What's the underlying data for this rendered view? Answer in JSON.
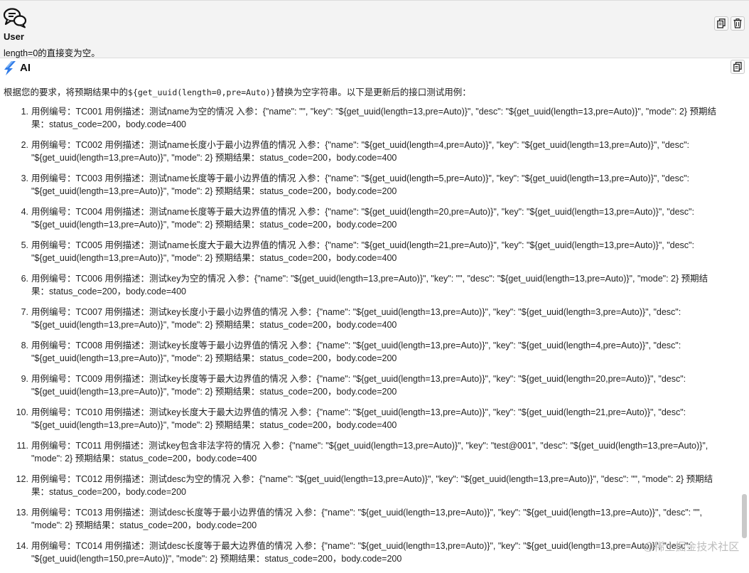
{
  "user": {
    "label": "User",
    "message": "length=0的直接变为空。"
  },
  "ai": {
    "label": "AI",
    "intro_prefix": "根据您的要求，将预期结果中的",
    "intro_code": "${get_uuid(length=0,pre=Auto)}",
    "intro_suffix": "替换为空字符串。以下是更新后的接口测试用例："
  },
  "cases": [
    {
      "num": "1.",
      "line1": "用例编号：TC001 用例描述：测试name为空的情况 入参：{\"name\": \"\", \"key\": \"${get_uuid(length=13,pre=Auto)}\", \"desc\": \"${get_uuid(length=13,pre=Auto)}\", \"mode\": 2} 预期结",
      "line2": "果：status_code=200，body.code=400"
    },
    {
      "num": "2.",
      "line1": "用例编号：TC002 用例描述：测试name长度小于最小边界值的情况 入参：{\"name\": \"${get_uuid(length=4,pre=Auto)}\", \"key\": \"${get_uuid(length=13,pre=Auto)}\", \"desc\":",
      "line2": "\"${get_uuid(length=13,pre=Auto)}\", \"mode\": 2} 预期结果：status_code=200，body.code=400"
    },
    {
      "num": "3.",
      "line1": "用例编号：TC003 用例描述：测试name长度等于最小边界值的情况 入参：{\"name\": \"${get_uuid(length=5,pre=Auto)}\", \"key\": \"${get_uuid(length=13,pre=Auto)}\", \"desc\":",
      "line2": "\"${get_uuid(length=13,pre=Auto)}\", \"mode\": 2} 预期结果：status_code=200，body.code=200"
    },
    {
      "num": "4.",
      "line1": "用例编号：TC004 用例描述：测试name长度等于最大边界值的情况 入参：{\"name\": \"${get_uuid(length=20,pre=Auto)}\", \"key\": \"${get_uuid(length=13,pre=Auto)}\", \"desc\":",
      "line2": "\"${get_uuid(length=13,pre=Auto)}\", \"mode\": 2} 预期结果：status_code=200，body.code=200"
    },
    {
      "num": "5.",
      "line1": "用例编号：TC005 用例描述：测试name长度大于最大边界值的情况 入参：{\"name\": \"${get_uuid(length=21,pre=Auto)}\", \"key\": \"${get_uuid(length=13,pre=Auto)}\", \"desc\":",
      "line2": "\"${get_uuid(length=13,pre=Auto)}\", \"mode\": 2} 预期结果：status_code=200，body.code=400"
    },
    {
      "num": "6.",
      "line1": "用例编号：TC006 用例描述：测试key为空的情况 入参：{\"name\": \"${get_uuid(length=13,pre=Auto)}\", \"key\": \"\", \"desc\": \"${get_uuid(length=13,pre=Auto)}\", \"mode\": 2} 预期结",
      "line2": "果：status_code=200，body.code=400"
    },
    {
      "num": "7.",
      "line1": "用例编号：TC007 用例描述：测试key长度小于最小边界值的情况 入参：{\"name\": \"${get_uuid(length=13,pre=Auto)}\", \"key\": \"${get_uuid(length=3,pre=Auto)}\", \"desc\":",
      "line2": "\"${get_uuid(length=13,pre=Auto)}\", \"mode\": 2} 预期结果：status_code=200，body.code=400"
    },
    {
      "num": "8.",
      "line1": "用例编号：TC008 用例描述：测试key长度等于最小边界值的情况 入参：{\"name\": \"${get_uuid(length=13,pre=Auto)}\", \"key\": \"${get_uuid(length=4,pre=Auto)}\", \"desc\":",
      "line2": "\"${get_uuid(length=13,pre=Auto)}\", \"mode\": 2} 预期结果：status_code=200，body.code=200"
    },
    {
      "num": "9.",
      "line1": "用例编号：TC009 用例描述：测试key长度等于最大边界值的情况 入参：{\"name\": \"${get_uuid(length=13,pre=Auto)}\", \"key\": \"${get_uuid(length=20,pre=Auto)}\", \"desc\":",
      "line2": "\"${get_uuid(length=13,pre=Auto)}\", \"mode\": 2} 预期结果：status_code=200，body.code=200"
    },
    {
      "num": "10.",
      "line1": "用例编号：TC010 用例描述：测试key长度大于最大边界值的情况 入参：{\"name\": \"${get_uuid(length=13,pre=Auto)}\", \"key\": \"${get_uuid(length=21,pre=Auto)}\", \"desc\":",
      "line2": "\"${get_uuid(length=13,pre=Auto)}\", \"mode\": 2} 预期结果：status_code=200，body.code=400"
    },
    {
      "num": "11.",
      "line1": "用例编号：TC011 用例描述：测试key包含非法字符的情况 入参：{\"name\": \"${get_uuid(length=13,pre=Auto)}\", \"key\": \"test@001\", \"desc\": \"${get_uuid(length=13,pre=Auto)}\",",
      "line2": "\"mode\": 2} 预期结果：status_code=200，body.code=400"
    },
    {
      "num": "12.",
      "line1": "用例编号：TC012 用例描述：测试desc为空的情况 入参：{\"name\": \"${get_uuid(length=13,pre=Auto)}\", \"key\": \"${get_uuid(length=13,pre=Auto)}\", \"desc\": \"\", \"mode\": 2} 预期结",
      "line2": "果：status_code=200，body.code=200"
    },
    {
      "num": "13.",
      "line1": "用例编号：TC013 用例描述：测试desc长度等于最小边界值的情况 入参：{\"name\": \"${get_uuid(length=13,pre=Auto)}\", \"key\": \"${get_uuid(length=13,pre=Auto)}\", \"desc\": \"\",",
      "line2": "\"mode\": 2} 预期结果：status_code=200，body.code=200"
    },
    {
      "num": "14.",
      "line1": "用例编号：TC014 用例描述：测试desc长度等于最大边界值的情况 入参：{\"name\": \"${get_uuid(length=13,pre=Auto)}\", \"key\": \"${get_uuid(length=13,pre=Auto)}\", \"desc\":",
      "line2": "\"${get_uuid(length=150,pre=Auto)}\", \"mode\": 2} 预期结果：status_code=200，body.code=200"
    }
  ],
  "watermark": "@稀土掘金技术社区",
  "icons": {
    "user_avatar": "chat-bubbles-icon",
    "ai_logo": "ai-logo-icon",
    "copy": "copy-icon",
    "delete": "trash-icon"
  },
  "colors": {
    "user_block_bg": "#f3f3f3",
    "ai_logo_blue": "#2f7be8"
  }
}
